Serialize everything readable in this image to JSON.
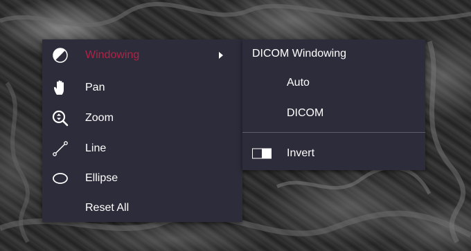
{
  "context_menu": {
    "items": [
      {
        "label": "Windowing",
        "icon": "contrast-icon",
        "active": true,
        "has_submenu": true
      },
      {
        "label": "Pan",
        "icon": "hand-icon"
      },
      {
        "label": "Zoom",
        "icon": "zoom-icon"
      },
      {
        "label": "Line",
        "icon": "line-icon"
      },
      {
        "label": "Ellipse",
        "icon": "ellipse-icon"
      },
      {
        "label": "Reset All",
        "icon": ""
      }
    ],
    "active_color": "#b22246"
  },
  "submenu": {
    "header": "DICOM Windowing",
    "items": [
      {
        "label": "Auto"
      },
      {
        "label": "DICOM"
      }
    ],
    "invert": {
      "label": "Invert",
      "icon": "toggle-icon"
    }
  },
  "colors": {
    "menu_bg": "#2c2c3a",
    "text": "#ffffff"
  }
}
